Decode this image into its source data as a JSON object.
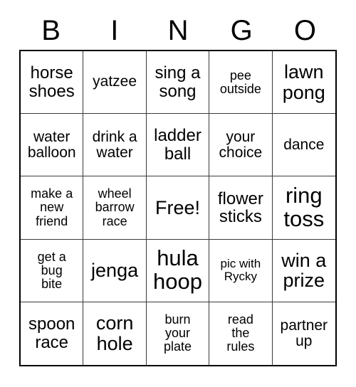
{
  "card": {
    "header_letters": [
      "B",
      "I",
      "N",
      "G",
      "O"
    ],
    "columns": 5,
    "rows": 5,
    "colors": {
      "background": "#ffffff",
      "text": "#000000",
      "outer_border": "#000000",
      "inner_border": "#3a3a3a"
    },
    "cells": [
      {
        "text": "horse\nshoes",
        "size": "md"
      },
      {
        "text": "yatzee",
        "size": "sm"
      },
      {
        "text": "sing a\nsong",
        "size": "md"
      },
      {
        "text": "pee\noutside",
        "size": "xs"
      },
      {
        "text": "lawn\npong",
        "size": "lg"
      },
      {
        "text": "water\nballoon",
        "size": "sm"
      },
      {
        "text": "drink a\nwater",
        "size": "sm"
      },
      {
        "text": "ladder\nball",
        "size": "md"
      },
      {
        "text": "your\nchoice",
        "size": "sm"
      },
      {
        "text": "dance",
        "size": "sm"
      },
      {
        "text": "make a\nnew\nfriend",
        "size": "xs"
      },
      {
        "text": "wheel\nbarrow\nrace",
        "size": "xs"
      },
      {
        "text": "Free!",
        "size": "lg"
      },
      {
        "text": "flower\nsticks",
        "size": "md"
      },
      {
        "text": "ring\ntoss",
        "size": "xl"
      },
      {
        "text": "get a\nbug\nbite",
        "size": "xs"
      },
      {
        "text": "jenga",
        "size": "lg"
      },
      {
        "text": "hula\nhoop",
        "size": "xl"
      },
      {
        "text": "pic with\nRycky",
        "size": "xxs"
      },
      {
        "text": "win a\nprize",
        "size": "lg"
      },
      {
        "text": "spoon\nrace",
        "size": "md"
      },
      {
        "text": "corn\nhole",
        "size": "lg"
      },
      {
        "text": "burn\nyour\nplate",
        "size": "xs"
      },
      {
        "text": "read\nthe\nrules",
        "size": "xs"
      },
      {
        "text": "partner\nup",
        "size": "sm"
      }
    ]
  }
}
